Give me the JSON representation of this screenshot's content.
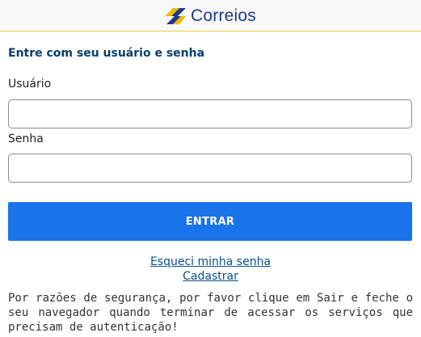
{
  "header": {
    "logo_text": "Correios",
    "logo_colors": {
      "yellow": "#f5b800",
      "blue": "#1b3a8a"
    }
  },
  "login": {
    "title": "Entre com seu usuário e senha",
    "user_label": "Usuário",
    "user_value": "",
    "password_label": "Senha",
    "password_value": "",
    "submit_label": "ENTRAR",
    "submit_color": "#1a73e8"
  },
  "links": {
    "forgot_password": "Esqueci minha senha",
    "register": "Cadastrar"
  },
  "notice": "Por razões de segurança, por favor clique em Sair e feche o seu navegador quando terminar de acessar os serviços que precisam de autenticação!"
}
